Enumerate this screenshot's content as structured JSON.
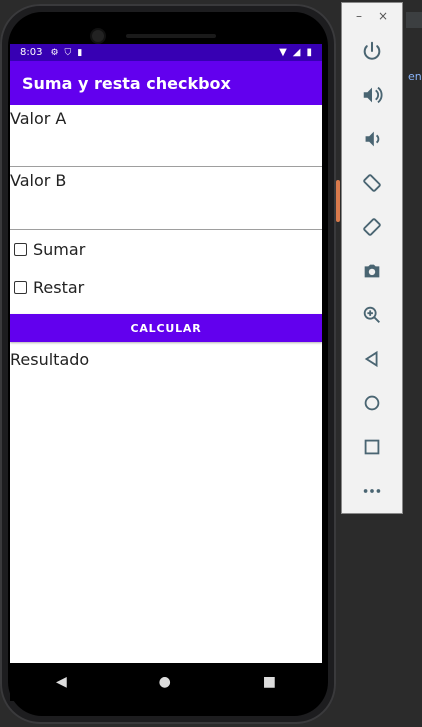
{
  "status_bar": {
    "time": "8:03"
  },
  "app": {
    "title": "Suma y resta checkbox"
  },
  "form": {
    "field_a_label": "Valor A",
    "field_a_value": "",
    "field_b_label": "Valor B",
    "field_b_value": "",
    "checkbox_sum_label": "Sumar",
    "checkbox_sum_checked": false,
    "checkbox_sub_label": "Restar",
    "checkbox_sub_checked": false,
    "calculate_label": "CALCULAR",
    "result_label": "Resultado"
  },
  "colors": {
    "status_bar": "#3700b3",
    "app_bar": "#6200ee",
    "button": "#6200ee"
  },
  "emulator_toolbar": {
    "minimize_label": "–",
    "close_label": "×",
    "items": [
      "power-icon",
      "volume-up-icon",
      "volume-down-icon",
      "rotate-left-icon",
      "rotate-right-icon",
      "camera-icon",
      "zoom-icon",
      "back-icon",
      "home-icon",
      "overview-icon",
      "more-icon"
    ]
  },
  "ide": {
    "partial_text": "en"
  }
}
